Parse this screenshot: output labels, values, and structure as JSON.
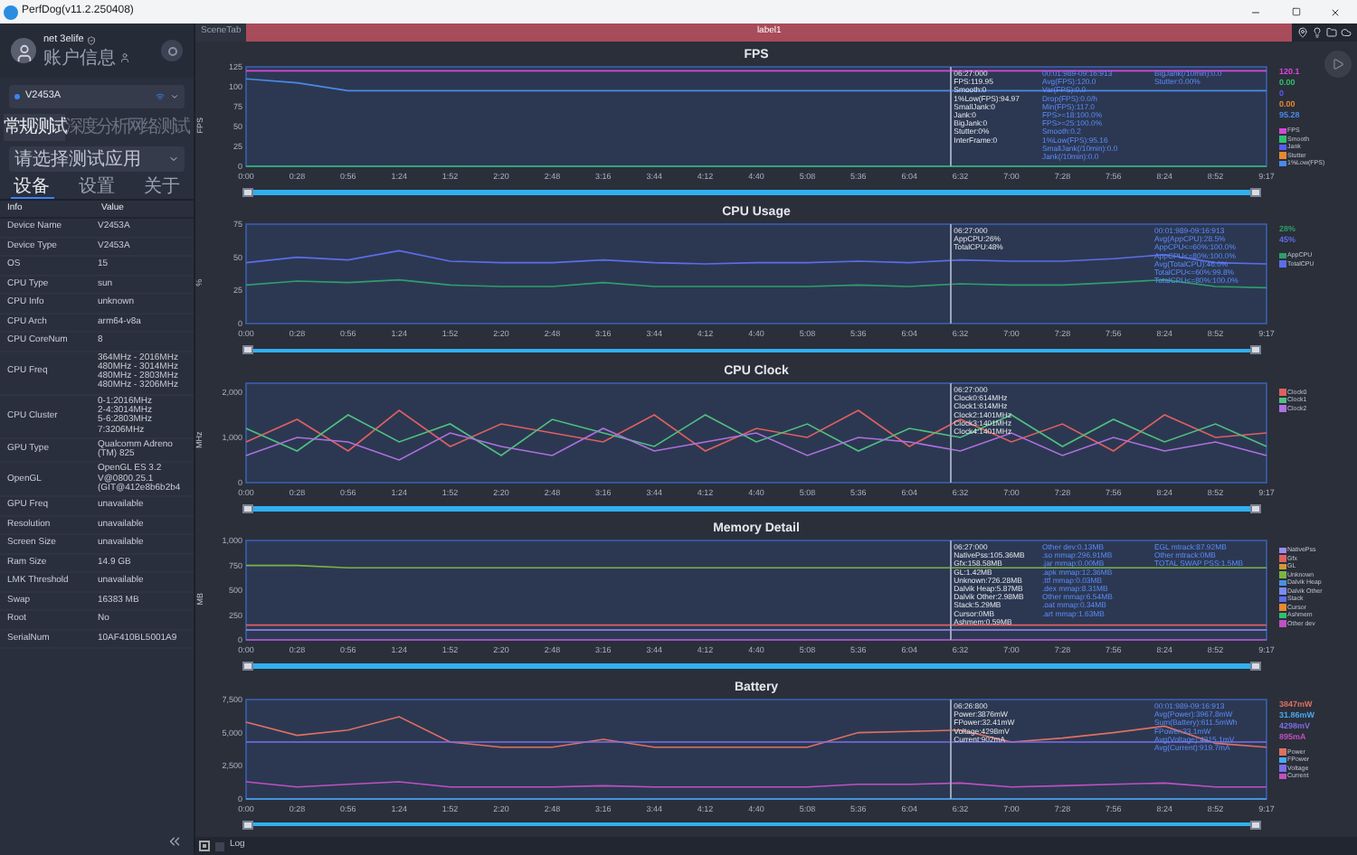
{
  "window": {
    "title": "PerfDog(v11.2.250408)"
  },
  "sidebar": {
    "user": {
      "name": "net 3elife",
      "account": "账户信息"
    },
    "device": "V2453A",
    "mode_tabs": [
      {
        "label": "常规测试",
        "selected": true
      },
      {
        "label": "深度分析",
        "selected": false
      },
      {
        "label": "网络测试",
        "selected": false
      }
    ],
    "app_select": {
      "placeholder": "请选择测试应用"
    },
    "info_tabs": [
      {
        "label": "设备",
        "selected": true
      },
      {
        "label": "设置",
        "selected": false
      },
      {
        "label": "关于",
        "selected": false
      }
    ],
    "table": {
      "columns": [
        "Info",
        "Value"
      ],
      "rows": [
        {
          "label": "Device Name",
          "value": "V2453A"
        },
        {
          "label": "Device Type",
          "value": "V2453A"
        },
        {
          "label": "OS",
          "value": "15"
        },
        {
          "label": "CPU Type",
          "value": "sun"
        },
        {
          "label": "CPU Info",
          "value": "unknown"
        },
        {
          "label": "CPU Arch",
          "value": "arm64-v8a"
        },
        {
          "label": "CPU CoreNum",
          "value": "8"
        },
        {
          "label": "CPU Freq",
          "value": "364MHz - 2016MHz\n480MHz - 3014MHz\n480MHz - 2803MHz\n480MHz - 3206MHz"
        },
        {
          "label": "CPU Cluster",
          "value": "0-1:2016MHz\n2-4:3014MHz\n5-6:2803MHz\n7:3206MHz"
        },
        {
          "label": "GPU Type",
          "value": "Qualcomm Adreno\n(TM) 825"
        },
        {
          "label": "OpenGL",
          "value": "OpenGL ES 3.2\nV@0800.25.1\n(GIT@412e8b6b2b4"
        },
        {
          "label": "GPU Freq",
          "value": "unavailable"
        },
        {
          "label": "Resolution",
          "value": "unavailable"
        },
        {
          "label": "Screen Size",
          "value": "unavailable"
        },
        {
          "label": "Ram Size",
          "value": "14.9 GB"
        },
        {
          "label": "LMK Threshold",
          "value": "unavailable"
        },
        {
          "label": "Swap",
          "value": "16383 MB"
        },
        {
          "label": "Root",
          "value": "No"
        },
        {
          "label": "SerialNum",
          "value": "10AF410BL5001A9"
        }
      ]
    }
  },
  "scene_tabs": [
    {
      "label": "SceneTab",
      "selected": false
    },
    {
      "label": "label1",
      "selected": true
    }
  ],
  "charts": [
    {
      "chart_data": {
        "type": "line",
        "title": "FPS",
        "ylabel": "FPS",
        "ylim": [
          0,
          125
        ],
        "yticks": [
          0,
          25,
          50,
          75,
          100,
          125
        ],
        "categories": [
          "0:00",
          "0:28",
          "0:56",
          "1:24",
          "1:52",
          "2:20",
          "2:48",
          "3:16",
          "3:44",
          "4:12",
          "4:40",
          "5:08",
          "5:36",
          "6:04",
          "6:32",
          "7:00",
          "7:28",
          "7:56",
          "8:24",
          "8:52",
          "9:17"
        ],
        "series": [
          {
            "name": "FPS",
            "color": "#d946d9",
            "values": [
              120,
              120,
              120,
              120,
              120,
              120,
              120,
              120,
              120,
              120,
              120,
              120,
              120,
              120,
              120,
              120,
              120,
              120,
              120,
              120,
              120
            ]
          },
          {
            "name": "Smooth",
            "color": "#2fbf71",
            "values": [
              0,
              0,
              0,
              0,
              0,
              0,
              0,
              0,
              0,
              0,
              0,
              0,
              0,
              0,
              0,
              0,
              0,
              0,
              0,
              0,
              0
            ]
          },
          {
            "name": "Jank",
            "color": "#5b5bf0",
            "values": [
              null,
              null,
              null,
              null,
              null,
              null,
              null,
              null,
              null,
              null,
              null,
              null,
              null,
              null,
              null,
              null,
              null,
              null,
              null,
              null,
              null
            ]
          },
          {
            "name": "Stutter",
            "color": "#e8882f",
            "values": [
              null,
              null,
              null,
              null,
              null,
              null,
              null,
              null,
              null,
              null,
              null,
              null,
              null,
              null,
              null,
              null,
              null,
              null,
              null,
              null,
              null
            ]
          },
          {
            "name": "1%Low(FPS)",
            "color": "#4a8ae8",
            "values": [
              110,
              105,
              95,
              95,
              95,
              95,
              95,
              95,
              95,
              95,
              95,
              95,
              95,
              95,
              95,
              95,
              95,
              95,
              95,
              95,
              95
            ]
          }
        ]
      },
      "slider": {
        "level": 1
      },
      "tooltip": [
        "06:27:000",
        "FPS:119.95",
        "Smooth:0",
        "1%Low(FPS):94.97",
        "SmallJank:0",
        "Jank:0",
        "BigJank:0",
        "Stutter:0%",
        "InterFrame:0"
      ],
      "stats": [
        [
          "00:01:989-09:16:913",
          "Avg(FPS):120.0",
          "Var(FPS):0.0",
          "Drop(FPS):0.0/h",
          "Min(FPS):117.0",
          "FPS>=18:100.0%",
          "FPS>=25:100.0%",
          "Smooth:0.2",
          "1%Low(FPS):95.16",
          "SmallJank(/10min):0.0",
          "Jank(/10min):0.0"
        ],
        [
          "BigJank(/10min):0.0",
          "Stutter:0.00%"
        ]
      ],
      "readouts": [
        "120.1",
        "0.00",
        "0",
        "0.00",
        "95.28"
      ]
    },
    {
      "chart_data": {
        "type": "line",
        "title": "CPU Usage",
        "ylabel": "%",
        "ylim": [
          0,
          75
        ],
        "yticks": [
          0,
          25,
          50,
          75
        ],
        "categories": [
          "0:00",
          "0:28",
          "0:56",
          "1:24",
          "1:52",
          "2:20",
          "2:48",
          "3:16",
          "3:44",
          "4:12",
          "4:40",
          "5:08",
          "5:36",
          "6:04",
          "6:32",
          "7:00",
          "7:28",
          "7:56",
          "8:24",
          "8:52",
          "9:17"
        ],
        "series": [
          {
            "name": "AppCPU",
            "color": "#2e9e6a",
            "values": [
              29,
              32,
              31,
              33,
              29,
              28,
              28,
              31,
              28,
              28,
              28,
              28,
              29,
              28,
              30,
              29,
              29,
              31,
              33,
              28,
              27
            ]
          },
          {
            "name": "TotalCPU",
            "color": "#5b6ee8",
            "values": [
              46,
              50,
              48,
              55,
              47,
              46,
              46,
              48,
              46,
              45,
              46,
              46,
              47,
              46,
              48,
              47,
              47,
              49,
              52,
              46,
              45
            ]
          }
        ]
      },
      "slider": {
        "level": 1
      },
      "tooltip": [
        "06:27:000",
        "AppCPU:26%",
        "TotalCPU:48%"
      ],
      "stats": [
        [
          "00:01:989-09:16:913",
          "Avg(AppCPU):28.5%",
          "AppCPU<=60%:100.0%",
          "AppCPU<=80%:100.0%",
          "Avg(TotalCPU):46.0%",
          "TotalCPU<=60%:99.8%",
          "TotalCPU<=80%:100.0%"
        ]
      ],
      "readouts": [
        "28%",
        "45%"
      ]
    },
    {
      "chart_data": {
        "type": "line",
        "title": "CPU Clock",
        "ylabel": "MHz",
        "ylim": [
          0,
          2200
        ],
        "yticks": [
          {
            "value": 0,
            "label": "0"
          },
          {
            "value": 1000,
            "label": "1,000"
          },
          {
            "value": 2000,
            "label": "2,000"
          }
        ],
        "categories": [
          "0:00",
          "0:28",
          "0:56",
          "1:24",
          "1:52",
          "2:20",
          "2:48",
          "3:16",
          "3:44",
          "4:12",
          "4:40",
          "5:08",
          "5:36",
          "6:04",
          "6:32",
          "7:00",
          "7:28",
          "7:56",
          "8:24",
          "8:52",
          "9:17"
        ],
        "series": [
          {
            "name": "Clock0",
            "color": "#e06060",
            "values": [
              900,
              1400,
              700,
              1600,
              800,
              1300,
              1100,
              900,
              1500,
              700,
              1200,
              1000,
              1600,
              800,
              1400,
              900,
              1300,
              700,
              1500,
              1000,
              1100
            ]
          },
          {
            "name": "Clock1",
            "color": "#50c080",
            "values": [
              1200,
              700,
              1500,
              900,
              1300,
              600,
              1400,
              1100,
              800,
              1500,
              900,
              1300,
              700,
              1200,
              1000,
              1500,
              800,
              1400,
              900,
              1300,
              800
            ]
          },
          {
            "name": "Clock2",
            "color": "#b070e0",
            "values": [
              600,
              1000,
              900,
              500,
              1100,
              800,
              600,
              1200,
              700,
              900,
              1100,
              600,
              1000,
              900,
              700,
              1100,
              600,
              1000,
              700,
              900,
              600
            ]
          }
        ]
      },
      "slider": {
        "level": 1
      },
      "tooltip": [
        "06:27:000",
        "Clock0:614MHz",
        "Clock1:614MHz",
        "Clock2:1401MHz",
        "Clock3:1401MHz",
        "Clock4:1401MHz"
      ]
    },
    {
      "chart_data": {
        "type": "line",
        "title": "Memory Detail",
        "ylabel": "MB",
        "ylim": [
          0,
          1000
        ],
        "yticks": [
          {
            "value": 0,
            "label": "0"
          },
          {
            "value": 250,
            "label": "250"
          },
          {
            "value": 500,
            "label": "500"
          },
          {
            "value": 750,
            "label": "750"
          },
          {
            "value": 1000,
            "label": "1,000"
          }
        ],
        "categories": [
          "0:00",
          "0:28",
          "0:56",
          "1:24",
          "1:52",
          "2:20",
          "2:48",
          "3:16",
          "3:44",
          "4:12",
          "4:40",
          "5:08",
          "5:36",
          "6:04",
          "6:32",
          "7:00",
          "7:28",
          "7:56",
          "8:24",
          "8:52",
          "9:17"
        ],
        "series": [
          {
            "name": "NativePss",
            "color": "#9b8cf0",
            "values": [
              100,
              100,
              100,
              100,
              100,
              100,
              100,
              100,
              100,
              100,
              100,
              100,
              100,
              100,
              100,
              100,
              100,
              100,
              100,
              100,
              100
            ]
          },
          {
            "name": "Gfx",
            "color": "#e06060",
            "values": [
              150,
              150,
              150,
              150,
              150,
              150,
              150,
              150,
              150,
              150,
              150,
              150,
              150,
              150,
              150,
              150,
              150,
              150,
              150,
              150,
              150
            ]
          },
          {
            "name": "GL",
            "color": "#d09a3a",
            "values": [
              null,
              null,
              null,
              null,
              null,
              null,
              null,
              null,
              null,
              null,
              null,
              null,
              null,
              null,
              null,
              null,
              null,
              null,
              null,
              null,
              null
            ]
          },
          {
            "name": "Unknown",
            "color": "#7cb342",
            "values": [
              750,
              750,
              725,
              725,
              725,
              725,
              725,
              725,
              725,
              725,
              725,
              725,
              725,
              725,
              725,
              725,
              725,
              725,
              725,
              725,
              725
            ]
          },
          {
            "name": "Dalvik Heap",
            "color": "#4a90e2",
            "values": [
              null,
              null,
              null,
              null,
              null,
              null,
              null,
              null,
              null,
              null,
              null,
              null,
              null,
              null,
              null,
              null,
              null,
              null,
              null,
              null,
              null
            ]
          },
          {
            "name": "Dalvik Other",
            "color": "#7b8cf0",
            "values": [
              null,
              null,
              null,
              null,
              null,
              null,
              null,
              null,
              null,
              null,
              null,
              null,
              null,
              null,
              null,
              null,
              null,
              null,
              null,
              null,
              null
            ]
          },
          {
            "name": "Stack",
            "color": "#5b6ee8",
            "values": [
              null,
              null,
              null,
              null,
              null,
              null,
              null,
              null,
              null,
              null,
              null,
              null,
              null,
              null,
              null,
              null,
              null,
              null,
              null,
              null,
              null
            ]
          },
          {
            "name": "Cursor",
            "color": "#e8882f",
            "values": [
              null,
              null,
              null,
              null,
              null,
              null,
              null,
              null,
              null,
              null,
              null,
              null,
              null,
              null,
              null,
              null,
              null,
              null,
              null,
              null,
              null
            ]
          },
          {
            "name": "Ashmem",
            "color": "#2fbf71",
            "values": [
              null,
              null,
              null,
              null,
              null,
              null,
              null,
              null,
              null,
              null,
              null,
              null,
              null,
              null,
              null,
              null,
              null,
              null,
              null,
              null,
              null
            ]
          },
          {
            "name": "Other dev",
            "color": "#c050c0",
            "values": [
              0,
              0,
              0,
              0,
              0,
              0,
              0,
              0,
              0,
              0,
              0,
              0,
              0,
              0,
              0,
              0,
              0,
              0,
              0,
              0,
              0
            ]
          }
        ]
      },
      "slider": {
        "level": 1
      },
      "tooltip": [
        "06:27:000",
        "NativePss:105.36MB",
        "Gfx:158.58MB",
        "GL:1.42MB",
        "Unknown:726.28MB",
        "Dalvik Heap:5.87MB",
        "Dalvik Other:2.98MB",
        "Stack:5.29MB",
        "Cursor:0MB",
        "Ashmem:0.59MB"
      ],
      "stats": [
        [
          "Other dev:0.13MB",
          ".so mmap:296.91MB",
          ".jar mmap:0.00MB",
          ".apk mmap:12.36MB",
          ".ttf mmap:0.03MB",
          ".dex mmap:8.31MB",
          "Other mmap:6.54MB",
          ".oat mmap:0.34MB",
          ".art mmap:1.63MB"
        ],
        [
          "EGL mtrack:87.92MB",
          "Other mtrack:0MB",
          "TOTAL SWAP PSS:1.5MB"
        ]
      ]
    },
    {
      "chart_data": {
        "type": "line",
        "title": "Battery",
        "ylim": [
          0,
          7500
        ],
        "yticks": [
          {
            "value": 0,
            "label": "0"
          },
          {
            "value": 2500,
            "label": "2,500"
          },
          {
            "value": 5000,
            "label": "5,000"
          },
          {
            "value": 7500,
            "label": "7,500"
          }
        ],
        "categories": [
          "0:00",
          "0:28",
          "0:56",
          "1:24",
          "1:52",
          "2:20",
          "2:48",
          "3:16",
          "3:44",
          "4:12",
          "4:40",
          "5:08",
          "5:36",
          "6:04",
          "6:32",
          "7:00",
          "7:28",
          "7:56",
          "8:24",
          "8:52",
          "9:17"
        ],
        "series": [
          {
            "name": "Power",
            "color": "#e07060",
            "values": [
              5800,
              4800,
              5200,
              6200,
              4300,
              3900,
              3900,
              4500,
              3900,
              3900,
              3900,
              3900,
              5000,
              5100,
              5200,
              4300,
              4600,
              5000,
              5500,
              4200,
              3900
            ]
          },
          {
            "name": "FPower",
            "color": "#4aa8f0",
            "values": [
              0,
              0,
              0,
              0,
              0,
              0,
              0,
              0,
              0,
              0,
              0,
              0,
              0,
              0,
              0,
              0,
              0,
              0,
              0,
              0,
              0
            ]
          },
          {
            "name": "Voltage",
            "color": "#7b6ee8",
            "values": [
              4300,
              4300,
              4300,
              4300,
              4300,
              4300,
              4300,
              4300,
              4300,
              4300,
              4300,
              4300,
              4300,
              4300,
              4300,
              4300,
              4300,
              4300,
              4300,
              4300,
              4300
            ]
          },
          {
            "name": "Current",
            "color": "#c050c0",
            "values": [
              1300,
              900,
              1100,
              1300,
              900,
              900,
              900,
              1000,
              900,
              900,
              900,
              900,
              1100,
              1100,
              1200,
              900,
              1000,
              1100,
              1200,
              900,
              900
            ]
          }
        ]
      },
      "slider": {
        "level": 1
      },
      "tooltip": [
        "06:26:800",
        "Power:3876mW",
        "FPower:32.41mW",
        "Voltage:4298mV",
        "Current:902mA"
      ],
      "stats": [
        [
          "00:01:989-09:16:913",
          "Avg(Power):3967.8mW",
          "Sum(Battery):611.5mWh",
          "FPower:33.1mW",
          "Avg(Voltage):4315.1mV",
          "Avg(Current):919.7mA"
        ]
      ],
      "readouts": [
        "3847mW",
        "31.86mW",
        "4298mV",
        "895mA"
      ]
    }
  ],
  "log": {
    "label": "Log",
    "checked": false
  }
}
